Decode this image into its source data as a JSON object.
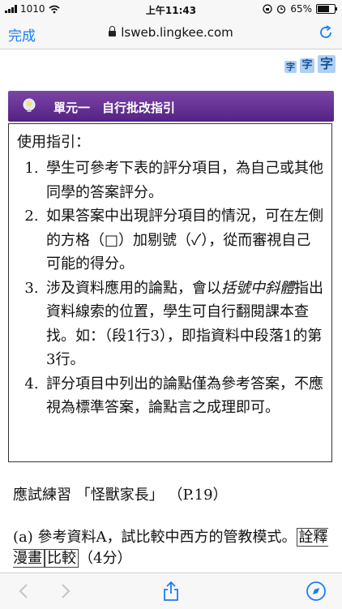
{
  "status_bar": {
    "carrier": "1010",
    "time": "上午11:43",
    "battery": "65%"
  },
  "browser": {
    "done_label": "完成",
    "url": "lsweb.lingkee.com"
  },
  "font_size_controls": [
    "字",
    "字",
    "字"
  ],
  "unit_banner": {
    "title": "單元一　自行批改指引"
  },
  "guide": {
    "heading": "使用指引：",
    "items": [
      {
        "num": "1.",
        "text": "學生可參考下表的評分項目，為自己或其他同學的答案評分。"
      },
      {
        "num": "2.",
        "text": "如果答案中出現評分項目的情況，可在左側的方格（□）加剔號（✓），從而審視自己可能的得分。"
      },
      {
        "num": "3.",
        "pre": "涉及資料應用的論點，會以",
        "emph": "括號中斜體",
        "post": "指出資料線索的位置，學生可自行翻閱課本查找。如：（段1行3），即指資料中段落1的第3行。"
      },
      {
        "num": "4.",
        "text": "評分項目中列出的論點僅為參考答案，不應視為標準答案，論點言之成理即可。"
      }
    ]
  },
  "exercise": {
    "title": "應試練習 「怪獸家長」 （P.19）"
  },
  "question": {
    "text": "(a) 參考資料A，試比較中西方的管教模式。",
    "tag1": "詮釋漫畫",
    "tag2": "比較",
    "marks": "（4分）"
  }
}
